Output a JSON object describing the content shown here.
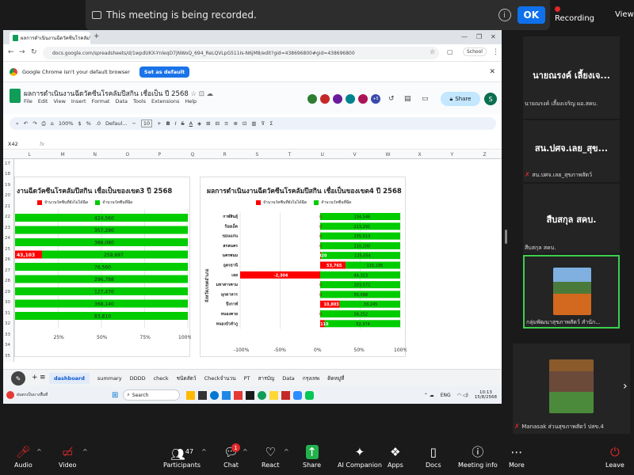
{
  "zoom": {
    "banner_text": "This meeting is being recorded.",
    "ok_label": "OK",
    "recording_label": "Recording",
    "view_label": "View",
    "participant_count": "47",
    "chat_badge": "1",
    "bottom_buttons": [
      "Audio",
      "Video",
      "Participants",
      "Chat",
      "React",
      "Share",
      "AI Companion",
      "Apps",
      "Docs",
      "Meeting info",
      "More",
      "Leave"
    ]
  },
  "gallery": {
    "tiles": [
      {
        "name": "นายณรงค์ เลี้ยงเจ...",
        "sub": "นายณรงค์ เลี้ยงเจริญ ผอ.สคบ."
      },
      {
        "name": "สน.ปศจ.เลย_สุข...",
        "sub": "สน.ปศจ.เลย_สุขภาพสัตว์"
      },
      {
        "name": "สืบสกุล สคบ.",
        "sub": "สืบสกุล สคบ."
      },
      {
        "name": "",
        "sub": "กลุ่มพัฒนาสุขภาพสัตว์ สำนัก..."
      },
      {
        "name": "",
        "sub": "Manasak ส่วนสุขภาพสัตว์ ปสข.4"
      }
    ]
  },
  "browser": {
    "tab_title": "ผลการดำเนินงานฉีดวัคซีนโรคลัมปีสกิน เชื่อเป็นของเขต",
    "url": "docs.google.com/spreadsheets/d/1wpdUKX-YnleqD7jNWoQ_694_ReLQVLpG511Is-N6jM8/edit?gid=438696800#gid=438696800",
    "profile": "School",
    "infobar_text": "Google Chrome isn't your default browser",
    "infobar_button": "Set as default"
  },
  "sheets": {
    "title": "ผลการดำเนินงานฉีดวัคซีนโรคลัมปีสกิน เชื่อเป็น ปี 2568",
    "menus": [
      "File",
      "Edit",
      "View",
      "Insert",
      "Format",
      "Data",
      "Tools",
      "Extensions",
      "Help"
    ],
    "share_label": "Share",
    "user_initial": "S",
    "extra_collab": "+5",
    "zoom_level": "100%",
    "font_name": "Defaul...",
    "font_size": "10",
    "cell_ref": "X42",
    "fx": "fx",
    "columns": [
      "L",
      "M",
      "N",
      "O",
      "P",
      "Q",
      "R",
      "S",
      "T",
      "U",
      "V",
      "W",
      "X",
      "Y",
      "Z"
    ],
    "rows": [
      "17",
      "18",
      "19",
      "20",
      "21",
      "22",
      "23",
      "24",
      "25",
      "26",
      "27",
      "28",
      "29",
      "30",
      "31",
      "32",
      "33",
      "34",
      "35"
    ],
    "tabs": [
      "dashboard",
      "summary",
      "DDDD",
      "check",
      "ชนิดสัตว์",
      "Checkจำนวน",
      "PT",
      "สารบัญ",
      "Data",
      "กรุงเทพ",
      "ติดหมู่ที่"
    ]
  },
  "left_chart": {
    "title": "งานฉีดวัคซีนโรคลัมปีสกิน เชื่อเป็นของเขต3 ปี 2568",
    "legend": [
      "จำนวนวัคซีนที่ยังไม่ได้ฉีด",
      "จำนวนวัคซีนที่ฉีด"
    ],
    "colors": {
      "pending": "#ff0000",
      "done": "#00cc00"
    },
    "bars": [
      {
        "red": null,
        "green": "424,560"
      },
      {
        "red": null,
        "green": "357,290"
      },
      {
        "red": null,
        "green": "388,080"
      },
      {
        "red": "43,103",
        "green": "259,697"
      },
      {
        "red": null,
        "green": "76,560"
      },
      {
        "red": null,
        "green": "296,788"
      },
      {
        "red": null,
        "green": "127,470"
      },
      {
        "red": null,
        "green": "368,140"
      },
      {
        "red": null,
        "green": "83,810"
      }
    ],
    "ticks": [
      "25%",
      "50%",
      "75%",
      "100%"
    ]
  },
  "chart_data": {
    "type": "bar",
    "title": "ผลการดำเนินงานฉีดวัคซีนโรคลัมปีสกิน เชื่อเป็นของเขต4 ปี 2568",
    "ylabel": "จังหวัด/เขตอำเภอ",
    "categories": [
      "กาฬสินธุ์",
      "ร้อยเอ็ด",
      "ขอนแก่น",
      "สกลนคร",
      "นครพนม",
      "อุดรธานี",
      "เลย",
      "มหาสารคาม",
      "มุกดาหาร",
      "บึงกาฬ",
      "หนองคาย",
      "หนองบัวลำภู"
    ],
    "series": [
      {
        "name": "จำนวนวัคซีนที่ยังไม่ได้ฉีด",
        "labels": [
          "0",
          "0",
          "0",
          "0",
          "1,820",
          "53,765",
          "-2,304",
          "0",
          "0",
          "10,803",
          "0",
          "3,118"
        ]
      },
      {
        "name": "จำนวนวัคซีนที่ฉีด",
        "labels": [
          "134,546",
          "213,291",
          "235,513",
          "210,200",
          "135,054",
          "115,195",
          "44,323",
          "203,572",
          "55,098",
          "33,245",
          "56,252",
          "52,374"
        ]
      }
    ],
    "pct_pending": [
      0,
      0,
      0,
      0,
      1.3,
      31.8,
      -100,
      0,
      0,
      24.5,
      0,
      5.6
    ],
    "pct_done": [
      100,
      100,
      100,
      100,
      98.7,
      68.2,
      100,
      100,
      100,
      75.5,
      100,
      94.4
    ],
    "xticks": [
      "-100%",
      "-50%",
      "0%",
      "50%",
      "100%"
    ],
    "xlim": [
      -100,
      100
    ]
  },
  "taskbar": {
    "search_placeholder": "Search",
    "lang": "ENG",
    "time": "10:13",
    "date": "15/8/2568",
    "weather": "ฝนตกเป็นบางพื้นที่"
  }
}
